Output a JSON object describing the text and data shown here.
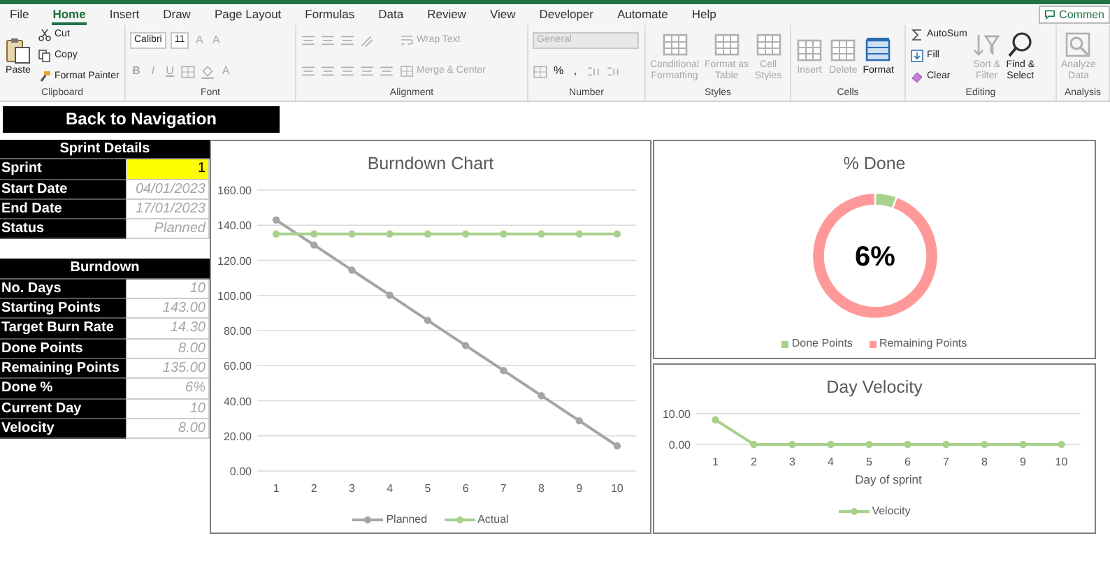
{
  "menu_tabs": [
    {
      "label": "File",
      "selected": false
    },
    {
      "label": "Home",
      "selected": true
    },
    {
      "label": "Insert",
      "selected": false
    },
    {
      "label": "Draw",
      "selected": false
    },
    {
      "label": "Page Layout",
      "selected": false
    },
    {
      "label": "Formulas",
      "selected": false
    },
    {
      "label": "Data",
      "selected": false
    },
    {
      "label": "Review",
      "selected": false
    },
    {
      "label": "View",
      "selected": false
    },
    {
      "label": "Developer",
      "selected": false
    },
    {
      "label": "Automate",
      "selected": false
    },
    {
      "label": "Help",
      "selected": false
    }
  ],
  "comments_button": "Commen",
  "ribbon": [
    {
      "label": "Clipboard",
      "columns": [
        [
          [
            {
              "kind": "large",
              "label": "Paste",
              "disabled": false
            }
          ]
        ],
        [
          [
            {
              "kind": "small",
              "label": "Cut",
              "disabled": false
            }
          ],
          [
            {
              "kind": "small",
              "label": "Copy",
              "disabled": false
            }
          ],
          [
            {
              "kind": "small",
              "label": "Format Painter",
              "disabled": false
            }
          ]
        ]
      ]
    },
    {
      "label": "Font",
      "columns": [
        [
          [
            {
              "kind": "field",
              "label": "Calibri",
              "disabled": false
            },
            {
              "kind": "field",
              "label": "11",
              "disabled": false
            },
            {
              "kind": "glyph",
              "label": "A",
              "disabled": true
            },
            {
              "kind": "glyph",
              "label": "A",
              "disabled": true
            }
          ],
          [
            {
              "kind": "glyph",
              "label": "B",
              "disabled": true
            },
            {
              "kind": "glyph",
              "label": "I",
              "disabled": true
            },
            {
              "kind": "glyph",
              "label": "U",
              "disabled": true
            },
            {
              "kind": "icon",
              "disabled": true
            },
            {
              "kind": "icon",
              "disabled": true
            },
            {
              "kind": "glyph",
              "label": "A",
              "disabled": true
            }
          ]
        ]
      ]
    },
    {
      "label": "Alignment",
      "columns": [
        [
          [
            {
              "kind": "icon",
              "disabled": true
            },
            {
              "kind": "icon",
              "disabled": true
            },
            {
              "kind": "icon",
              "disabled": true
            },
            {
              "kind": "icon",
              "disabled": true
            }
          ],
          [
            {
              "kind": "icon",
              "disabled": true
            },
            {
              "kind": "icon",
              "disabled": true
            },
            {
              "kind": "icon",
              "disabled": true
            },
            {
              "kind": "icon",
              "disabled": true
            },
            {
              "kind": "icon",
              "disabled": true
            }
          ]
        ],
        [
          [
            {
              "kind": "small",
              "label": "Wrap Text",
              "disabled": true
            }
          ],
          [
            {
              "kind": "small",
              "label": "Merge & Center",
              "disabled": true
            }
          ]
        ]
      ]
    },
    {
      "label": "Number",
      "columns": [
        [
          [
            {
              "kind": "field",
              "label": "General",
              "disabled": true
            }
          ],
          [
            {
              "kind": "icon",
              "disabled": true
            },
            {
              "kind": "glyph",
              "label": "%",
              "disabled": false
            },
            {
              "kind": "glyph",
              "label": ",",
              "disabled": false
            },
            {
              "kind": "icon",
              "disabled": true
            },
            {
              "kind": "icon",
              "disabled": true
            }
          ]
        ]
      ]
    },
    {
      "label": "Styles",
      "columns": [
        [
          [
            {
              "kind": "large",
              "label": "Conditional\nFormatting",
              "disabled": true
            }
          ]
        ],
        [
          [
            {
              "kind": "large",
              "label": "Format as\nTable",
              "disabled": true
            }
          ]
        ],
        [
          [
            {
              "kind": "large",
              "label": "Cell\nStyles",
              "disabled": true
            }
          ]
        ]
      ]
    },
    {
      "label": "Cells",
      "columns": [
        [
          [
            {
              "kind": "large",
              "label": "Insert",
              "disabled": true
            }
          ]
        ],
        [
          [
            {
              "kind": "large",
              "label": "Delete",
              "disabled": true
            }
          ]
        ],
        [
          [
            {
              "kind": "large",
              "label": "Format",
              "disabled": false
            }
          ]
        ]
      ]
    },
    {
      "label": "Editing",
      "columns": [
        [
          [
            {
              "kind": "small",
              "label": "AutoSum",
              "disabled": false
            }
          ],
          [
            {
              "kind": "small",
              "label": "Fill",
              "disabled": false
            }
          ],
          [
            {
              "kind": "small",
              "label": "Clear",
              "disabled": false
            }
          ]
        ],
        [
          [
            {
              "kind": "large",
              "label": "Sort &\nFilter",
              "disabled": true
            }
          ]
        ],
        [
          [
            {
              "kind": "large",
              "label": "Find &\nSelect",
              "disabled": false
            }
          ]
        ]
      ]
    },
    {
      "label": "Analysis",
      "columns": [
        [
          [
            {
              "kind": "large",
              "label": "Analyze\nData",
              "disabled": true
            }
          ]
        ]
      ]
    }
  ],
  "back_button": "Back to Navigation",
  "sprint_details": {
    "title": "Sprint Details",
    "rows": [
      {
        "label": "Sprint",
        "value": "1",
        "highlighted": true
      },
      {
        "label": "Start Date",
        "value": "04/01/2023",
        "highlighted": false
      },
      {
        "label": "End Date",
        "value": "17/01/2023",
        "highlighted": false
      },
      {
        "label": "Status",
        "value": "Planned",
        "highlighted": false
      }
    ]
  },
  "burndown": {
    "title": "Burndown",
    "rows": [
      {
        "label": "No. Days",
        "value": "10",
        "highlighted": false
      },
      {
        "label": "Starting Points",
        "value": "143.00",
        "highlighted": false
      },
      {
        "label": "Target Burn Rate",
        "value": "14.30",
        "highlighted": false
      },
      {
        "label": "Done Points",
        "value": "8.00",
        "highlighted": false
      },
      {
        "label": "Remaining Points",
        "value": "135.00",
        "highlighted": false
      },
      {
        "label": "Done %",
        "value": "6%",
        "highlighted": false
      },
      {
        "label": "Current Day",
        "value": "10",
        "highlighted": false
      },
      {
        "label": "Velocity",
        "value": "8.00",
        "highlighted": false
      }
    ]
  },
  "burndown_chart": {
    "chart_data": {
      "type": "line",
      "title": "Burndown Chart",
      "categories": [
        "1",
        "2",
        "3",
        "4",
        "5",
        "6",
        "7",
        "8",
        "9",
        "10"
      ],
      "grid": true,
      "series": [
        {
          "name": "Planned",
          "color": "#a5a5a5",
          "marker": true,
          "values": [
            143,
            128.7,
            114.4,
            100.1,
            85.8,
            71.5,
            57.2,
            42.9,
            28.6,
            14.3
          ]
        },
        {
          "name": "Actual",
          "color": "#a9d18e",
          "marker": true,
          "values": [
            135,
            135,
            135,
            135,
            135,
            135,
            135,
            135,
            135,
            135
          ]
        }
      ],
      "ylim": [
        0,
        160
      ],
      "yticks": [
        {
          "value": 0,
          "label": "0.00"
        },
        {
          "value": 20,
          "label": "20.00"
        },
        {
          "value": 40,
          "label": "40.00"
        },
        {
          "value": 60,
          "label": "60.00"
        },
        {
          "value": 80,
          "label": "80.00"
        },
        {
          "value": 100,
          "label": "100.00"
        },
        {
          "value": 120,
          "label": "120.00"
        },
        {
          "value": 140,
          "label": "140.00"
        },
        {
          "value": 160,
          "label": "160.00"
        }
      ]
    }
  },
  "done_chart": {
    "center_text": "6%",
    "chart_data": {
      "type": "donut",
      "title": "% Done",
      "categories": [
        "Done Points",
        "Remaining Points"
      ],
      "values": [
        5.6,
        94.4
      ],
      "colors": [
        "#a9d18e",
        "#ff9999"
      ]
    }
  },
  "velocity_chart": {
    "chart_data": {
      "type": "line",
      "title": "Day Velocity",
      "xlabel": "Day of sprint",
      "categories": [
        "1",
        "2",
        "3",
        "4",
        "5",
        "6",
        "7",
        "8",
        "9",
        "10"
      ],
      "grid": true,
      "series": [
        {
          "name": "Velocity",
          "color": "#a9d18e",
          "marker": true,
          "values": [
            8,
            0,
            0,
            0,
            0,
            0,
            0,
            0,
            0,
            0
          ]
        }
      ],
      "ylim": [
        0,
        10
      ],
      "yticks": [
        {
          "value": 0,
          "label": "0.00"
        },
        {
          "value": 10,
          "label": "10.00"
        }
      ]
    }
  }
}
